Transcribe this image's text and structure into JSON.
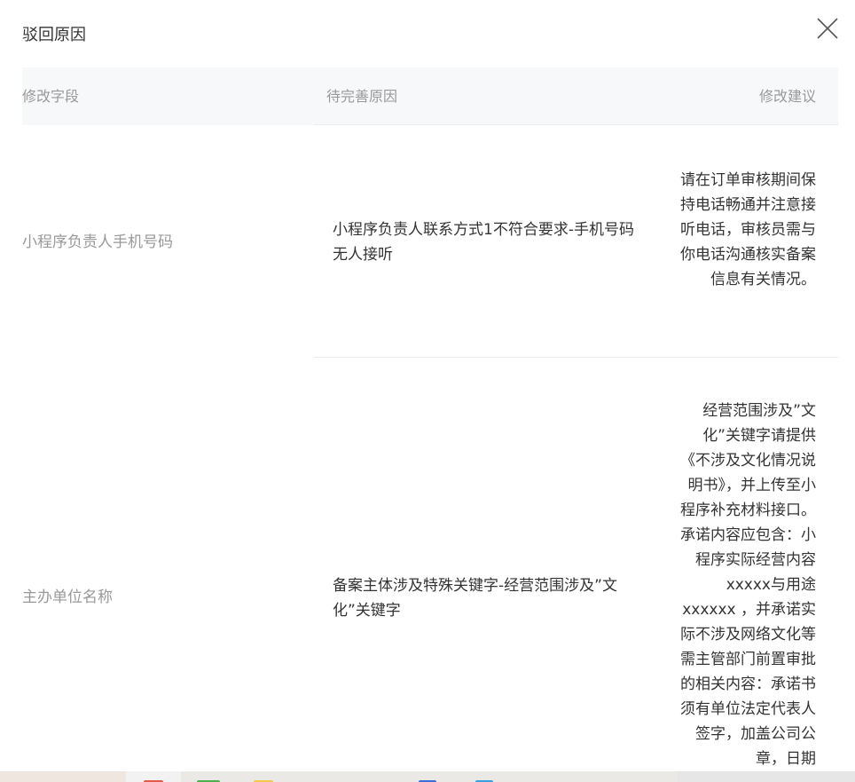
{
  "dialog": {
    "title": "驳回原因",
    "close_icon": "close-icon"
  },
  "table": {
    "headers": {
      "field": "修改字段",
      "reason": "待完善原因",
      "suggestion": "修改建议"
    },
    "rows": [
      {
        "field": "小程序负责人手机号码",
        "reason": "小程序负责人联系方式1不符合要求-手机号码无人接听",
        "suggestion": "请在订单审核期间保持电话畅通并注意接听电话，审核员需与你电话沟通核实备案信息有关情况。"
      },
      {
        "field": "主办单位名称",
        "reason": "备案主体涉及特殊关键字-经营范围涉及”文化”关键字",
        "suggestion": "经营范围涉及”文化”关键字请提供《不涉及文化情况说明书》，并上传至小程序补充材料接口。承诺内容应包含：小程序实际经营内容xxxxx与用途xxxxxx ，并承诺实际不涉及网络文化等需主管部门前置审批的相关内容：承诺书须有单位法定代表人签字，加盖公司公章，日期"
      }
    ]
  },
  "colors": {
    "header_bg": "#f7f8fa",
    "muted_text": "#999999",
    "body_text": "#333333",
    "divider": "#ececec"
  }
}
